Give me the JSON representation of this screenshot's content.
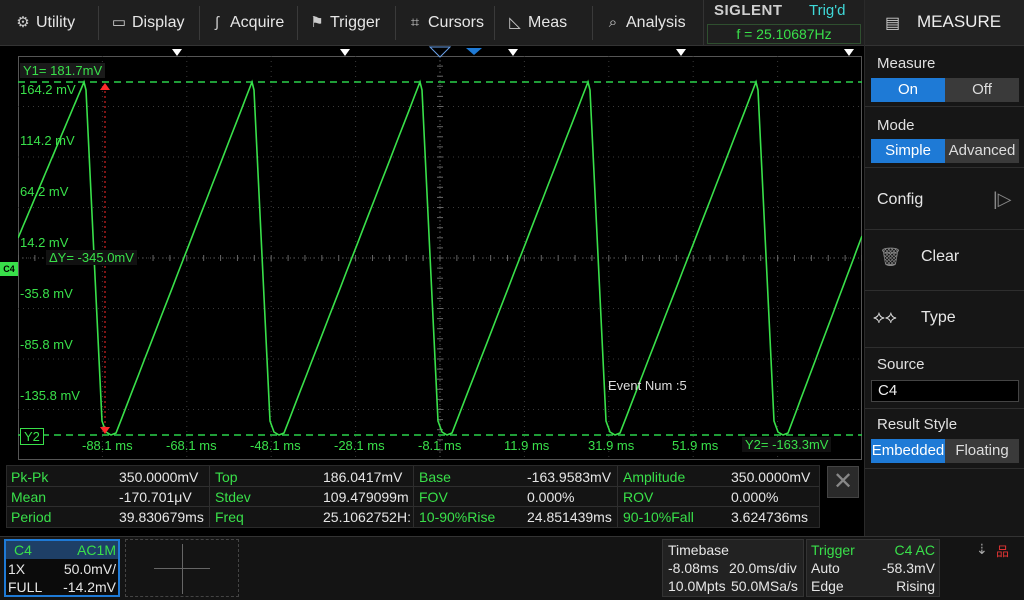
{
  "menu": [
    {
      "label": "Utility",
      "icon": "utility-icon"
    },
    {
      "label": "Display",
      "icon": "display-icon"
    },
    {
      "label": "Acquire",
      "icon": "acquire-icon"
    },
    {
      "label": "Trigger",
      "icon": "trigger-icon"
    },
    {
      "label": "Cursors",
      "icon": "cursors-icon"
    },
    {
      "label": "Meas",
      "icon": "meas-icon"
    },
    {
      "label": "Analysis",
      "icon": "analysis-icon"
    }
  ],
  "brand": "SIGLENT",
  "trigger_state": "Trig'd",
  "trigger_freq": "f = 25.10687Hz",
  "panel": {
    "title": "MEASURE",
    "measure_label": "Measure",
    "measure_on": "On",
    "measure_off": "Off",
    "mode_label": "Mode",
    "mode_simple": "Simple",
    "mode_advanced": "Advanced",
    "config": "Config",
    "clear": "Clear",
    "type": "Type",
    "source_label": "Source",
    "source_value": "C4",
    "result_style_label": "Result Style",
    "embedded": "Embedded",
    "floating": "Floating"
  },
  "scope": {
    "channel_marker": "C4",
    "y_labels": [
      "164.2 mV",
      "114.2 mV",
      "64.2 mV",
      "14.2 mV",
      "-35.8 mV",
      "-85.8 mV",
      "-135.8 mV"
    ],
    "x_labels": [
      "-88.1 ms",
      "-68.1 ms",
      "-48.1 ms",
      "-28.1 ms",
      "-8.1 ms",
      "11.9 ms",
      "31.9 ms",
      "51.9 ms"
    ],
    "cursor_y1": "Y1= 181.7mV",
    "cursor_y2": "Y2",
    "cursor_y2_value": "Y2= -163.3mV",
    "delta_y": "ΔY= -345.0mV",
    "event_num": "Event Num :5",
    "colors": {
      "trace": "#39e04a",
      "cursor": "#2bd14a",
      "marker": "#ff2a2a",
      "trigger": "#1e7ad6"
    }
  },
  "measurements": [
    [
      {
        "name": "Pk-Pk",
        "value": "350.0000mV"
      },
      {
        "name": "Top",
        "value": "186.0417mV"
      },
      {
        "name": "Base",
        "value": "-163.9583mV"
      },
      {
        "name": "Amplitude",
        "value": "350.0000mV"
      }
    ],
    [
      {
        "name": "Mean",
        "value": "-170.701μV"
      },
      {
        "name": "Stdev",
        "value": "109.479099m"
      },
      {
        "name": "FOV",
        "value": "0.000%"
      },
      {
        "name": "ROV",
        "value": "0.000%"
      }
    ],
    [
      {
        "name": "Period",
        "value": "39.830679ms"
      },
      {
        "name": "Freq",
        "value": "25.1062752H:"
      },
      {
        "name": "10-90%Rise",
        "value": "24.851439ms"
      },
      {
        "name": "90-10%Fall",
        "value": "3.624736ms"
      }
    ]
  ],
  "channel": {
    "name": "C4",
    "coupling": "AC1M",
    "probe": "1X",
    "scale": "50.0mV/",
    "bandwidth": "FULL",
    "offset": "-14.2mV"
  },
  "timebase": {
    "label": "Timebase",
    "delay": "-8.08ms",
    "scale": "20.0ms/div",
    "memory": "10.0Mpts",
    "sample_rate": "50.0MSa/s"
  },
  "trigger": {
    "label": "Trigger",
    "source": "C4 AC",
    "mode": "Auto",
    "level": "-58.3mV",
    "type": "Edge",
    "slope": "Rising"
  }
}
